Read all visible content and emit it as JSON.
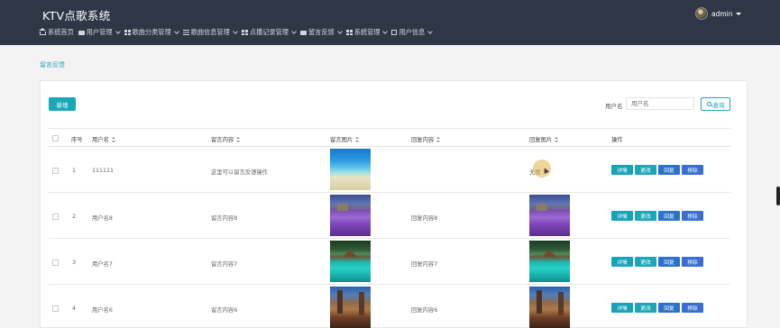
{
  "app": {
    "title": "KTV点歌系统",
    "user": "admin"
  },
  "nav": [
    {
      "label": "系统首页",
      "icon": "home-icon",
      "dropdown": false
    },
    {
      "label": "用户管理",
      "icon": "user-icon",
      "dropdown": true
    },
    {
      "label": "歌曲分类管理",
      "icon": "grid-icon",
      "dropdown": true
    },
    {
      "label": "歌曲信息管理",
      "icon": "list-icon",
      "dropdown": true
    },
    {
      "label": "点播记录管理",
      "icon": "grid-icon",
      "dropdown": true
    },
    {
      "label": "留言反馈",
      "icon": "message-icon",
      "dropdown": true
    },
    {
      "label": "系统管理",
      "icon": "grid-icon",
      "dropdown": true
    },
    {
      "label": "用户信息",
      "icon": "doc-icon",
      "dropdown": true
    }
  ],
  "breadcrumb": "留言反馈",
  "toolbar": {
    "add_label": "新增",
    "search_label": "用户名",
    "search_placeholder": "用户名",
    "search_button": "查询"
  },
  "table": {
    "headers": {
      "index": "序号",
      "username": "用户名",
      "content": "留言内容",
      "image": "留言图片",
      "reply": "回复内容",
      "reply_image": "回复图片",
      "actions": "操作"
    },
    "rows": [
      {
        "index": "1",
        "username": "111111",
        "content": "这里可以留言反馈操作",
        "image": "beach",
        "reply": "",
        "reply_image_text": "无图",
        "reply_image": ""
      },
      {
        "index": "2",
        "username": "用户名8",
        "content": "留言内容8",
        "image": "lavender",
        "reply": "回复内容8",
        "reply_image_text": "",
        "reply_image": "lavender"
      },
      {
        "index": "3",
        "username": "用户名7",
        "content": "留言内容7",
        "image": "island",
        "reply": "回复内容7",
        "reply_image_text": "",
        "reply_image": "island"
      },
      {
        "index": "4",
        "username": "用户名6",
        "content": "留言内容6",
        "image": "city",
        "reply": "回复内容6",
        "reply_image_text": "",
        "reply_image": "city"
      }
    ],
    "actions": {
      "detail": "详情",
      "edit": "更改",
      "reply": "回复",
      "remove": "移除"
    }
  },
  "colors": {
    "header_bg": "#2f3747",
    "accent": "#1aa8b8",
    "reply_button": "#2c73c8"
  }
}
